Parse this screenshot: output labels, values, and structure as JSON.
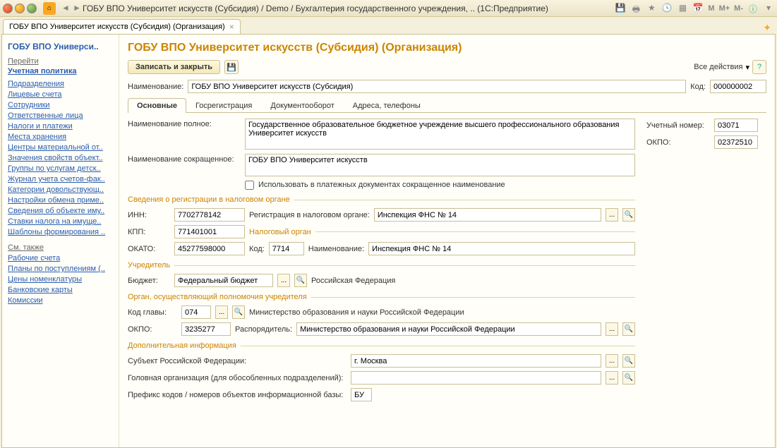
{
  "titlebar": {
    "title": "ГОБУ ВПО Университет искусств (Субсидия) / Demo / Бухгалтерия государственного учреждения, ..  (1С:Предприятие)",
    "mem": [
      "M",
      "M+",
      "M-"
    ]
  },
  "doctab": {
    "label": "ГОБУ ВПО Университет искусств (Субсидия) (Организация)"
  },
  "sidebar": {
    "title": "ГОБУ ВПО Универси..",
    "goto": "Перейти",
    "policy": "Учетная политика",
    "links": [
      "Подразделения",
      "Лицевые счета",
      "Сотрудники",
      "Ответственные лица",
      "Налоги и платежи",
      "Места хранения",
      "Центры материальной от..",
      "Значения свойств объект..",
      "Группы по услугам детск..",
      "Журнал учета счетов-фак..",
      "Категории довольствующ..",
      "Настройки обмена приме..",
      "Сведения об объекте иму..",
      "Ставки налога на имуще..",
      "Шаблоны формирования .."
    ],
    "seealso": "См. также",
    "links2": [
      "Рабочие счета",
      "Планы по поступлениям (..",
      "Цены номенклатуры",
      "Банковские карты",
      "Комиссии"
    ]
  },
  "page": {
    "title": "ГОБУ ВПО Университет искусств (Субсидия) (Организация)",
    "save_close": "Записать и закрыть",
    "all_actions": "Все действия"
  },
  "header": {
    "name_lbl": "Наименование:",
    "name_val": "ГОБУ ВПО Университет искусств (Субсидия)",
    "code_lbl": "Код:",
    "code_val": "000000002"
  },
  "tabs": [
    "Основные",
    "Госрегистрация",
    "Документооборот",
    "Адреса, телефоны"
  ],
  "form": {
    "full_name_lbl": "Наименование полное:",
    "full_name_val": "Государственное образовательное бюджетное учреждение высшего профессионального образования Университет искусств",
    "short_name_lbl": "Наименование сокращенное:",
    "short_name_val": "ГОБУ ВПО Университет искусств",
    "use_short_lbl": "Использовать в платежных документах сокращенное наименование",
    "reg_section": "Сведения о регистрации в налоговом органе",
    "inn_lbl": "ИНН:",
    "inn_val": "7702778142",
    "reg_lbl": "Регистрация в налоговом органе:",
    "reg_val": "Инспекция ФНС № 14",
    "kpp_lbl": "КПП:",
    "kpp_val": "771401001",
    "tax_section": "Налоговый орган",
    "okato_lbl": "ОКАТО:",
    "okato_val": "45277598000",
    "kod_lbl": "Код:",
    "kod_val": "7714",
    "naim_lbl": "Наименование:",
    "naim_val": "Инспекция ФНС № 14",
    "founder_section": "Учредитель",
    "budget_lbl": "Бюджет:",
    "budget_val": "Федеральный бюджет",
    "budget_txt": "Российская Федерация",
    "organ_section": "Орган, осуществляющий полномочия учредителя",
    "glava_lbl": "Код главы:",
    "glava_val": "074",
    "glava_txt": "Министерство образования и науки Российской Федерации",
    "okpo2_lbl": "ОКПО:",
    "okpo2_val": "3235277",
    "rasp_lbl": "Распорядитель:",
    "rasp_val": "Министерство образования и науки Российской Федерации",
    "addinfo_section": "Дополнительная информация",
    "subj_lbl": "Субъект Российской Федерации:",
    "subj_val": "г. Москва",
    "head_lbl": "Головная организация (для обособленных подразделений):",
    "head_val": "",
    "prefix_lbl": "Префикс кодов / номеров объектов информационной базы:",
    "prefix_val": "БУ",
    "uchnum_lbl": "Учетный номер:",
    "uchnum_val": "03071",
    "okpo_lbl": "ОКПО:",
    "okpo_val": "02372510"
  }
}
